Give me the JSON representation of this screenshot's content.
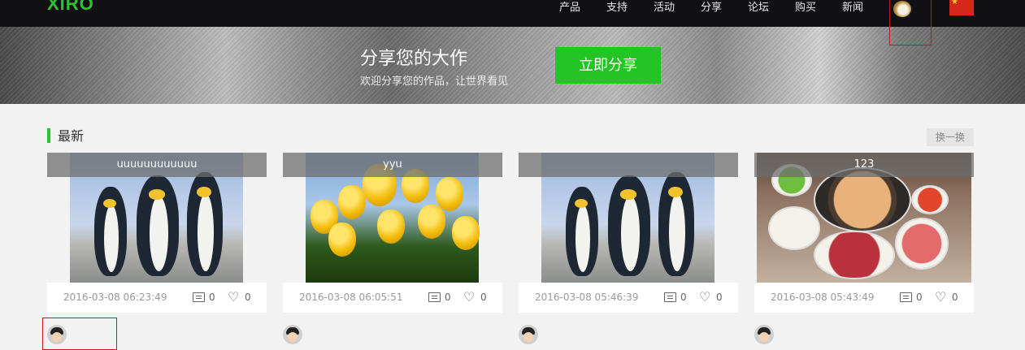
{
  "header": {
    "logo": "XIRO",
    "nav": [
      "产品",
      "支持",
      "活动",
      "分享",
      "论坛",
      "购买",
      "新闻"
    ],
    "flag_color": "#d7261a"
  },
  "banner": {
    "title": "分享您的大作",
    "subtitle": "欢迎分享您的作品，让世界看见",
    "button": "立即分享"
  },
  "section": {
    "title": "最新",
    "swap_button": "换一换"
  },
  "cards": [
    {
      "caption": "uuuuuuuuuuuu",
      "date": "2016-03-08 06:23:49",
      "comments": "0",
      "likes": "0",
      "image": "penguins"
    },
    {
      "caption": "yyu",
      "date": "2016-03-08 06:05:51",
      "comments": "0",
      "likes": "0",
      "image": "tulips"
    },
    {
      "caption": "",
      "date": "2016-03-08 05:46:39",
      "comments": "0",
      "likes": "0",
      "image": "penguins"
    },
    {
      "caption": "123",
      "date": "2016-03-08 05:43:49",
      "comments": "0",
      "likes": "0",
      "image": "hotpot"
    }
  ],
  "colors": {
    "accent": "#24c424",
    "nav_bg": "#111113",
    "page_bg": "#f2f2f2"
  }
}
